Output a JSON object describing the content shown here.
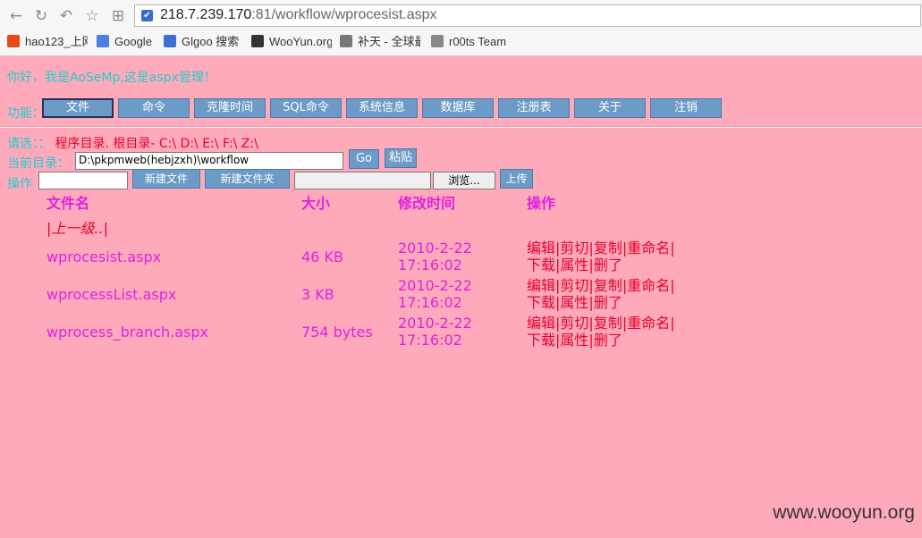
{
  "browser": {
    "url_host": "218.7.239.170",
    "url_rest": ":81/workflow/wprocesist.aspx",
    "bookmarks": [
      {
        "label": "hao123_上网",
        "icon": "hao123-icon",
        "color": "#e64a19"
      },
      {
        "label": "Google",
        "icon": "google-icon",
        "color": "#4a7fe6"
      },
      {
        "label": "Glgoo 搜索",
        "icon": "glgoo-icon",
        "color": "#3b6fd6"
      },
      {
        "label": "WooYun.org",
        "icon": "wooyun-icon",
        "color": "#333333"
      },
      {
        "label": "补天 - 全球最",
        "icon": "star-icon",
        "color": "#777777"
      },
      {
        "label": "r00ts Team",
        "icon": "page-icon",
        "color": "#888888"
      }
    ]
  },
  "page": {
    "greeting": "你好，我是AoSeMp,这是aspx管理！",
    "func_label": "功能：",
    "func_buttons": [
      "文件",
      "命令",
      "克隆时间",
      "SQL命令",
      "系统信息",
      "数据库",
      "注册表",
      "关于",
      "注销"
    ],
    "please_label": "请选：：",
    "program_dir": "程序目录.",
    "root_dir": "根目录-",
    "drives": "C:\\ D:\\ E:\\ F:\\ Z:\\",
    "current_dir_label": "当前目录：",
    "current_dir_value": "D:\\pkpmweb(hebjzxh)\\workflow",
    "go_label": "Go",
    "paste_label": "粘贴",
    "op_label": "操作",
    "new_file_label": "新建文件",
    "new_folder_label": "新建文件夹",
    "browse_label": "浏览...",
    "upload_label": "上传"
  },
  "table": {
    "headers": {
      "name": "文件名",
      "size": "大小",
      "mtime": "修改时间",
      "ops": "操作"
    },
    "parent": "|上一级..|",
    "rows": [
      {
        "name": "wprocesist.aspx",
        "size": "46 KB",
        "date": "2010-2-22",
        "time": "17:16:02"
      },
      {
        "name": "wprocessList.aspx",
        "size": "3 KB",
        "date": "2010-2-22",
        "time": "17:16:02"
      },
      {
        "name": "wprocess_branch.aspx",
        "size": "754 bytes",
        "date": "2010-2-22",
        "time": "17:16:02"
      }
    ],
    "ops_line1": [
      "编辑",
      "剪切",
      "复制",
      "重命名"
    ],
    "ops_line2": [
      "下载",
      "属性",
      "删了"
    ]
  },
  "watermark": "www.wooyun.org"
}
